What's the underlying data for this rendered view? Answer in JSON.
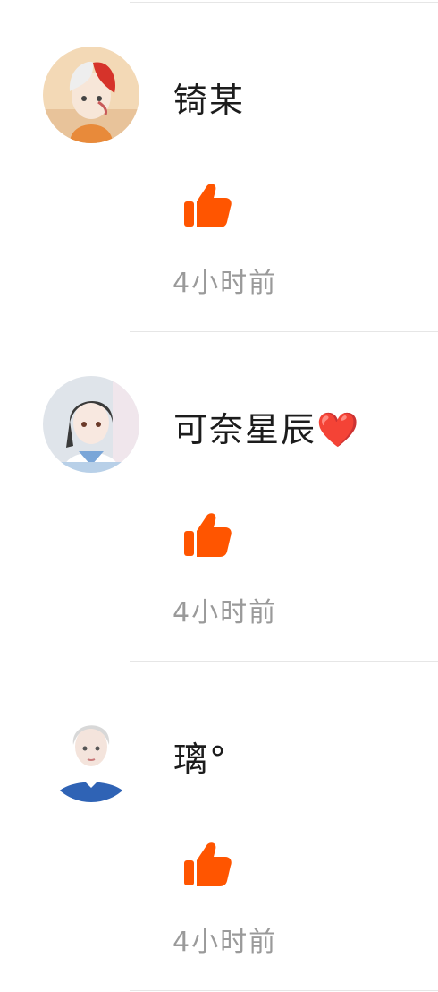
{
  "colors": {
    "like": "#ff5500",
    "divider": "#e6e6e6",
    "time_text": "#9a9a9a",
    "name_text": "#1c1c1c"
  },
  "likers": [
    {
      "name": "锜某",
      "time": "4小时前",
      "avatar": "avatar-white-red-hair-boy",
      "like_icon": "thumbs-up-icon"
    },
    {
      "name": "可奈星辰❤️",
      "time": "4小时前",
      "avatar": "avatar-dark-hair-girl",
      "like_icon": "thumbs-up-icon"
    },
    {
      "name": "璃°",
      "time": "4小时前",
      "avatar": "avatar-silver-hair-boy",
      "like_icon": "thumbs-up-icon"
    }
  ]
}
